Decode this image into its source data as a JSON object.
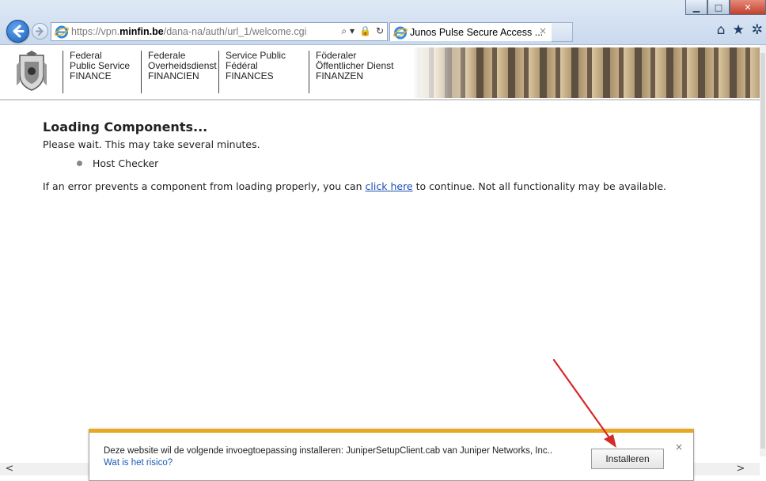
{
  "browser": {
    "url_prefix": "https://vpn.",
    "url_domain": "minfin.be",
    "url_path": "/dana-na/auth/url_1/welcome.cgi",
    "address_tools": [
      "⌕ ▾",
      "🔒",
      "↻"
    ],
    "tab_title": "Junos Pulse Secure Access ...",
    "tab_close": "×",
    "toolbar_icons": [
      "⌂",
      "★",
      "✲"
    ],
    "window_controls": {
      "minimize": "▁",
      "maximize": "□",
      "close": "✕"
    }
  },
  "header": {
    "columns": [
      [
        "Federal",
        "Public Service",
        "FINANCE"
      ],
      [
        "Federale",
        "Overheidsdienst",
        "FINANCIEN"
      ],
      [
        "Service Public",
        "Fédéral",
        "FINANCES"
      ],
      [
        "Föderaler",
        "Öffentlicher Dienst",
        "FINANZEN"
      ]
    ]
  },
  "content": {
    "title": "Loading Components...",
    "wait_message": "Please wait. This may take several minutes.",
    "components": [
      "Host Checker"
    ],
    "error_prefix": "If an error prevents a component from loading properly, you can ",
    "error_link": "click here",
    "error_suffix": " to continue. Not all functionality may be available."
  },
  "scroll": {
    "left_arrow": "<",
    "right_arrow": ">"
  },
  "notification": {
    "message": "Deze website wil de volgende invoegtoepassing installeren: JuniperSetupClient.cab van Juniper Networks, Inc..",
    "risk_link": "Wat is het risico?",
    "install_label": "Installeren",
    "close": "×",
    "accent_color": "#e8a822"
  },
  "annotation": {
    "arrow_color": "#d42a2a"
  }
}
